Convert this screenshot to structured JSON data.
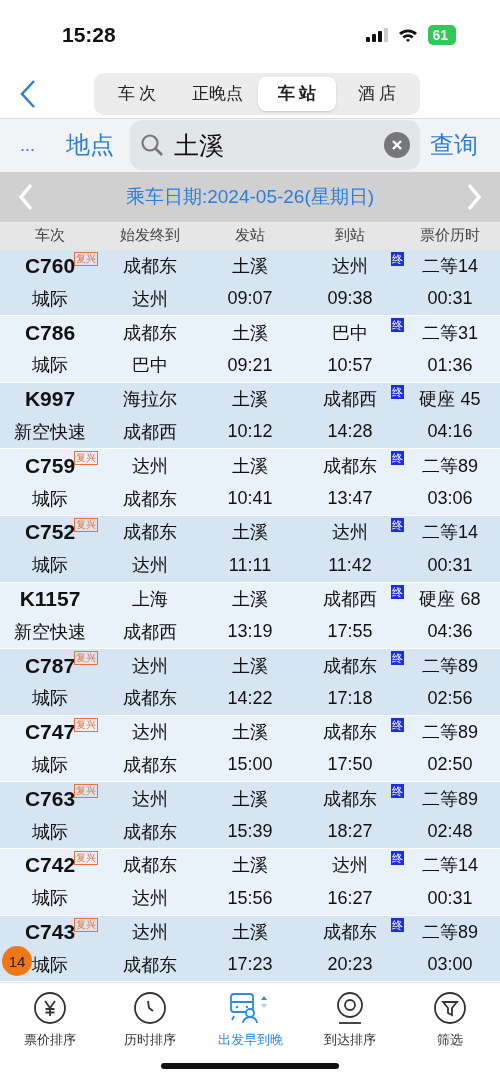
{
  "status_bar": {
    "time": "15:28",
    "battery": "61"
  },
  "tabs": [
    {
      "label": "车 次",
      "selected": false
    },
    {
      "label": "正晚点",
      "selected": false
    },
    {
      "label": "车 站",
      "selected": true
    },
    {
      "label": "酒 店",
      "selected": false
    }
  ],
  "search_row": {
    "more": "...",
    "location": "地点",
    "value": "土溪",
    "query": "查询"
  },
  "date_bar": {
    "text": "乘车日期:2024-05-26(星期日)"
  },
  "columns": [
    "车次",
    "始发终到",
    "发站",
    "到站",
    "票价历时"
  ],
  "rows": [
    {
      "train": "C760",
      "badge": "复兴",
      "type": "城际",
      "origin": "成都东",
      "terminus": "达州",
      "from": "土溪",
      "depart": "09:07",
      "to": "达州",
      "arrive": "09:38",
      "terminal": true,
      "terminal_mark": "终",
      "price": "二等14",
      "duration": "00:31"
    },
    {
      "train": "C786",
      "type": "城际",
      "origin": "成都东",
      "terminus": "巴中",
      "from": "土溪",
      "depart": "09:21",
      "to": "巴中",
      "arrive": "10:57",
      "terminal": true,
      "terminal_mark": "终",
      "price": "二等31",
      "duration": "01:36"
    },
    {
      "train": "K997",
      "type": "新空快速",
      "origin": "海拉尔",
      "terminus": "成都西",
      "from": "土溪",
      "depart": "10:12",
      "to": "成都西",
      "arrive": "14:28",
      "terminal": true,
      "terminal_mark": "终",
      "price": "硬座 45",
      "duration": "04:16"
    },
    {
      "train": "C759",
      "badge": "复兴",
      "type": "城际",
      "origin": "达州",
      "terminus": "成都东",
      "from": "土溪",
      "depart": "10:41",
      "to": "成都东",
      "arrive": "13:47",
      "terminal": true,
      "terminal_mark": "终",
      "price": "二等89",
      "duration": "03:06"
    },
    {
      "train": "C752",
      "badge": "复兴",
      "type": "城际",
      "origin": "成都东",
      "terminus": "达州",
      "from": "土溪",
      "depart": "11:11",
      "to": "达州",
      "arrive": "11:42",
      "terminal": true,
      "terminal_mark": "终",
      "price": "二等14",
      "duration": "00:31"
    },
    {
      "train": "K1157",
      "type": "新空快速",
      "origin": "上海",
      "terminus": "成都西",
      "from": "土溪",
      "depart": "13:19",
      "to": "成都西",
      "arrive": "17:55",
      "terminal": true,
      "terminal_mark": "终",
      "price": "硬座 68",
      "duration": "04:36"
    },
    {
      "train": "C787",
      "badge": "复兴",
      "type": "城际",
      "origin": "达州",
      "terminus": "成都东",
      "from": "土溪",
      "depart": "14:22",
      "to": "成都东",
      "arrive": "17:18",
      "terminal": true,
      "terminal_mark": "终",
      "price": "二等89",
      "duration": "02:56"
    },
    {
      "train": "C747",
      "badge": "复兴",
      "type": "城际",
      "origin": "达州",
      "terminus": "成都东",
      "from": "土溪",
      "depart": "15:00",
      "to": "成都东",
      "arrive": "17:50",
      "terminal": true,
      "terminal_mark": "终",
      "price": "二等89",
      "duration": "02:50"
    },
    {
      "train": "C763",
      "badge": "复兴",
      "type": "城际",
      "origin": "达州",
      "terminus": "成都东",
      "from": "土溪",
      "depart": "15:39",
      "to": "成都东",
      "arrive": "18:27",
      "terminal": true,
      "terminal_mark": "终",
      "price": "二等89",
      "duration": "02:48"
    },
    {
      "train": "C742",
      "badge": "复兴",
      "type": "城际",
      "origin": "成都东",
      "terminus": "达州",
      "from": "土溪",
      "depart": "15:56",
      "to": "达州",
      "arrive": "16:27",
      "terminal": true,
      "terminal_mark": "终",
      "price": "二等14",
      "duration": "00:31"
    },
    {
      "train": "C743",
      "badge": "复兴",
      "type": "城际",
      "origin": "达州",
      "terminus": "成都东",
      "from": "土溪",
      "depart": "17:23",
      "to": "成都东",
      "arrive": "20:23",
      "terminal": true,
      "terminal_mark": "终",
      "price": "二等89",
      "duration": "03:00"
    }
  ],
  "count_badge": "14",
  "bottom_tabs": [
    {
      "kind": "price",
      "label": "票价排序",
      "selected": false
    },
    {
      "kind": "duration",
      "label": "历时排序",
      "selected": false
    },
    {
      "kind": "depart",
      "label": "出发早到晚",
      "selected": true
    },
    {
      "kind": "arrive",
      "label": "到达排序",
      "selected": false
    },
    {
      "kind": "filter",
      "label": "筛选",
      "selected": false
    }
  ]
}
